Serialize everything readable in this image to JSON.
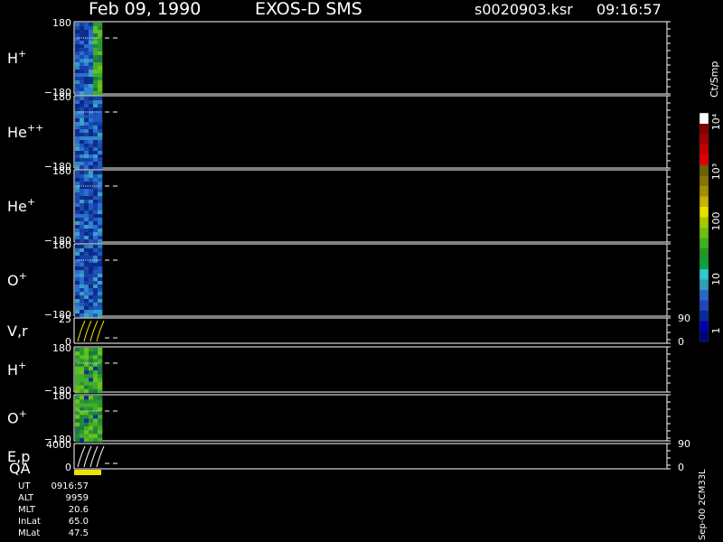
{
  "header": {
    "date": "Feb 09, 1990",
    "mission": "EXOS-D SMS",
    "file": "s0020903.ksr",
    "time": "09:16:57"
  },
  "panels": [
    {
      "id": "h-plus",
      "label": "H",
      "sup": "+",
      "ymax": "180",
      "ymin": "−180",
      "kind": "spectrogram",
      "palette": "blue"
    },
    {
      "id": "he-pp",
      "label": "He",
      "sup": "++",
      "ymax": "180",
      "ymin": "−180",
      "kind": "spectrogram",
      "palette": "blue"
    },
    {
      "id": "he-plus",
      "label": "He",
      "sup": "+",
      "ymax": "180",
      "ymin": "−180",
      "kind": "spectrogram",
      "palette": "blue"
    },
    {
      "id": "o-plus",
      "label": "O",
      "sup": "+",
      "ymax": "180",
      "ymin": "−180",
      "kind": "spectrogram",
      "palette": "blue"
    },
    {
      "id": "vr",
      "label": "V,r",
      "sup": "",
      "ymax": "25",
      "ymin": "0",
      "kind": "line",
      "right_top": "90",
      "right_bottom": "0"
    },
    {
      "id": "h-plus-2",
      "label": "H",
      "sup": "+",
      "ymax": "180",
      "ymin": "−180",
      "kind": "spectrogram",
      "palette": "green"
    },
    {
      "id": "o-plus-2",
      "label": "O",
      "sup": "+",
      "ymax": "180",
      "ymin": "−180",
      "kind": "spectrogram",
      "palette": "green"
    },
    {
      "id": "ep",
      "label": "E,p",
      "sup": "",
      "ymax": "4000",
      "ymin": "0",
      "kind": "line",
      "right_top": "90",
      "right_bottom": "0"
    }
  ],
  "qa_label": "QA",
  "info": [
    {
      "label": "UT",
      "value": "0916:57"
    },
    {
      "label": "ALT",
      "value": "9959"
    },
    {
      "label": "MLT",
      "value": "20.6"
    },
    {
      "label": "InLat",
      "value": "65.0"
    },
    {
      "label": "MLat",
      "value": "47.5"
    }
  ],
  "colorbar": {
    "units": "Ct/Smp",
    "tick_labels": [
      "1",
      "10",
      "100",
      "10³",
      "10⁴"
    ],
    "colors": [
      "#000080",
      "#0000aa",
      "#0a2a9a",
      "#1a4ab4",
      "#2a66c8",
      "#2fa0b8",
      "#30c8c8",
      "#10a040",
      "#209820",
      "#40b020",
      "#70c010",
      "#a8c800",
      "#e8e000",
      "#c8b400",
      "#a09000",
      "#887400",
      "#6e6000",
      "#e00000",
      "#c00000",
      "#a00000",
      "#800000",
      "#ffffff"
    ]
  },
  "footer_label": "Sep-00  2CM33L",
  "colors": {
    "background": "#000000",
    "foreground": "#ffffff",
    "qa_bar": "#f0e000"
  }
}
